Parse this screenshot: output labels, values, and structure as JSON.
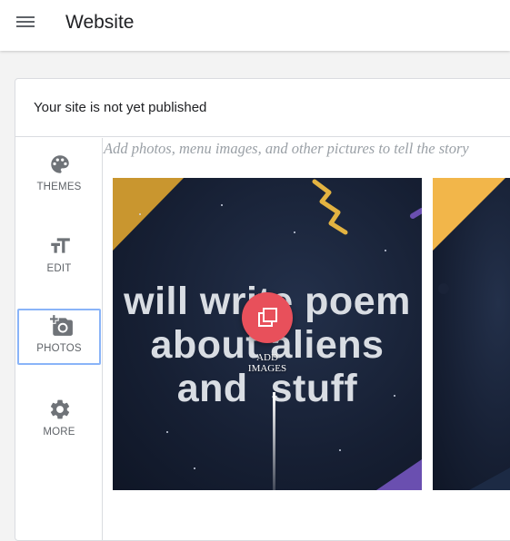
{
  "header": {
    "title": "Website",
    "menu_icon": "hamburger-menu-icon"
  },
  "status": {
    "text": "Your site is not yet published"
  },
  "sidebar": {
    "items": [
      {
        "label": "THEMES",
        "icon": "palette-icon"
      },
      {
        "label": "EDIT",
        "icon": "text-size-icon"
      },
      {
        "label": "PHOTOS",
        "icon": "add-photo-icon",
        "active": true
      },
      {
        "label": "MORE",
        "icon": "gear-icon"
      }
    ]
  },
  "content": {
    "hint": "Add photos, menu images, and other pictures to tell the story",
    "main_photo": {
      "text": "will write poem\nabout aliens\nand  stuff"
    },
    "add_button": {
      "label": "ADD\nIMAGES"
    }
  },
  "colors": {
    "accent_red": "#e8505b",
    "active_outline": "#8ab4f8",
    "photo_background": "#161f33",
    "gold": "#c9962f",
    "purple": "#6a4fb0"
  }
}
